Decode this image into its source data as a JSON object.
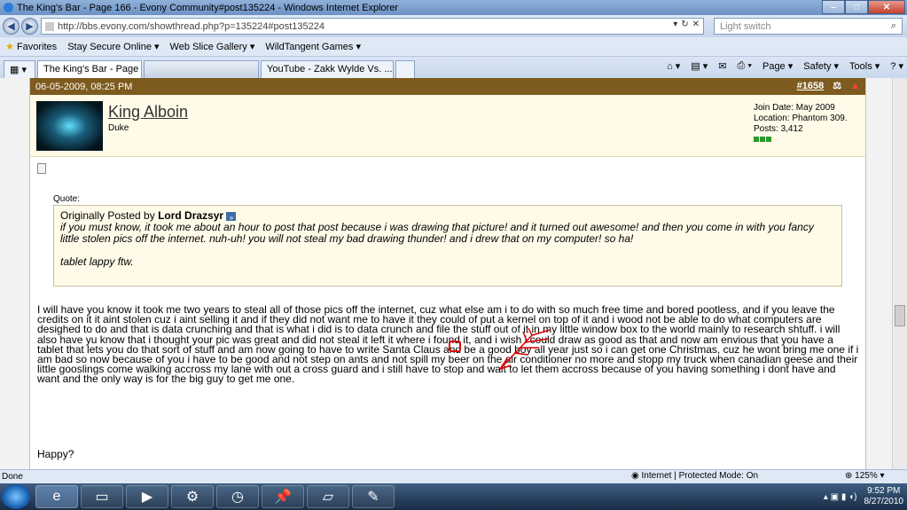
{
  "window": {
    "title": "The King's Bar - Page 166 - Evony Community#post135224 - Windows Internet Explorer"
  },
  "address": {
    "url": "http://bbs.evony.com/showthread.php?p=135224#post135224",
    "search_placeholder": "Light switch"
  },
  "favorites": {
    "label": "Favorites",
    "items": [
      "Stay Secure Online ▾",
      "Web Slice Gallery ▾",
      "WildTangent Games ▾"
    ]
  },
  "tabs": [
    {
      "label": "The King's Bar - Page 1..."
    },
    {
      "label": ""
    },
    {
      "label": "YouTube - Zakk Wylde Vs. ..."
    }
  ],
  "tabtools": [
    "Page ▾",
    "Safety ▾",
    "Tools ▾"
  ],
  "post": {
    "date": "06-05-2009, 08:25 PM",
    "number": "#1658",
    "username": "King Alboin",
    "user_title": "Duke",
    "join_date": "Join Date: May 2009",
    "location": "Location: Phantom 309.",
    "posts": "Posts: 3,412",
    "quote_label": "Quote:",
    "quote_prefix": "Originally Posted by",
    "quote_author": "Lord Drazsyr",
    "quote_text": "if you must know, it took me about an hour to post that post because i was drawing that picture! and it turned out awesome! and then you come in with you fancy little stolen pics off the internet. nuh-uh! you will not steal my bad drawing thunder! and i drew that on my computer! so ha!",
    "quote_sig": "tablet lappy ftw.",
    "body": "I will have you know it took me two years to steal all of those pics off the internet, cuz what else am i to do with so much free time and bored pootless, and if you leave the credits on it it aint stolen cuz i aint selling it and if they did not want me to have it they could of put a kernel on top of it and i wood not be able to do what computers are desighed to do and that is data crunching and that is what i did is to data crunch and file the stuff out of it in my little window box to the world mainly to research shtuff. i will also have yu know that i thought your pic was great and did not steal it left it where i found it, and i wish i could draw as good as that and now am envious that you have a tablet that lets you do that sort of stuff and am now going to have to write Santa Claus and be a good boy all year just so i can get one Christmas, cuz he wont bring me one if i am bad so now because of you i have to be good and not step on ants and not spill my beer on the air conditioner no more and stopp my truck when canadian geese and their little gooslings come walking accross my lane with out a cross guard and i still have to stop and wait to let them accross because of you having something i dont have and want and the only way is for the big guy to get me one.",
    "closing": "Happy?"
  },
  "status": {
    "left": "Done",
    "zone": "Internet | Protected Mode: On",
    "zoom": "125%"
  },
  "clock": {
    "time": "9:52 PM",
    "date": "8/27/2010"
  },
  "colors": {
    "post_header": "#7d5a1e",
    "annotation": "#e00000"
  }
}
